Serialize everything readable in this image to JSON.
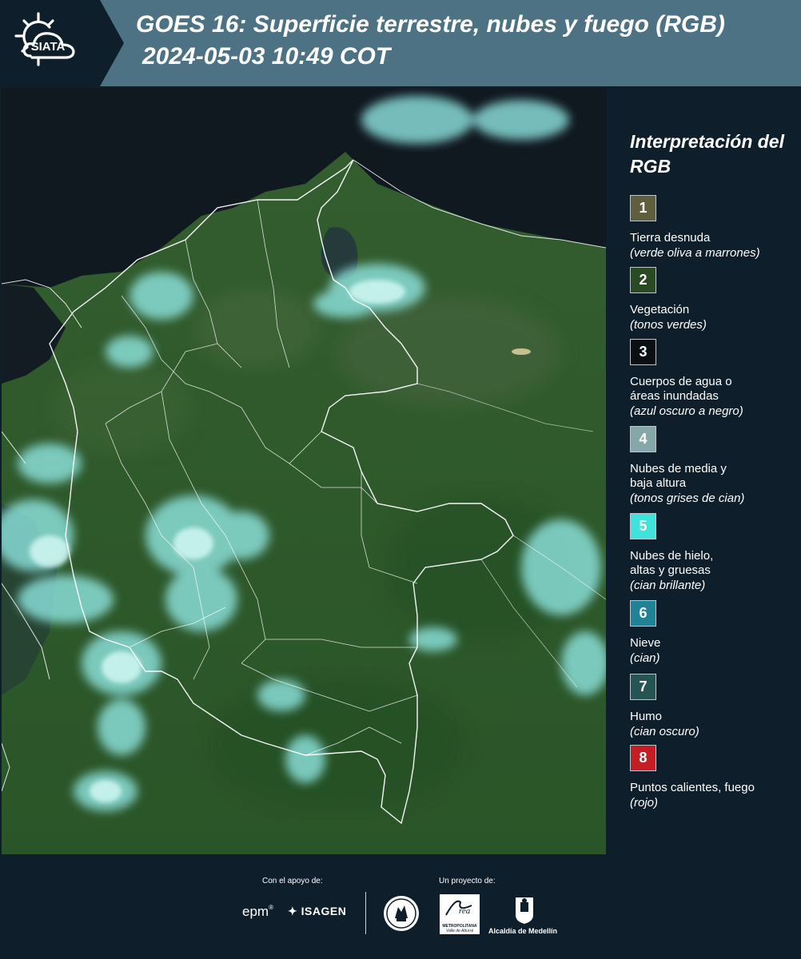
{
  "header": {
    "logo_text": "SIATA",
    "title": "GOES 16: Superficie terrestre, nubes y fuego (RGB)",
    "timestamp": "2024-05-03 10:49 COT"
  },
  "legend": {
    "title": "Interpretación del RGB",
    "items": [
      {
        "number": "1",
        "label": "Tierra desnuda",
        "note": "(verde oliva a marrones)",
        "color": "#5f5e3f"
      },
      {
        "number": "2",
        "label": "Vegetación",
        "note": "(tonos verdes)",
        "color": "#2a4a24"
      },
      {
        "number": "3",
        "label": "Cuerpos de agua o\náreas inundadas",
        "note": "(azul oscuro a negro)",
        "color": "#0a0f14"
      },
      {
        "number": "4",
        "label": "Nubes de media y\nbaja altura",
        "note": "(tonos grises de cian)",
        "color": "#86a7a8"
      },
      {
        "number": "5",
        "label": "Nubes de hielo,\naltas y gruesas",
        "note": "(cian brillante)",
        "color": "#3fe2dc"
      },
      {
        "number": "6",
        "label": "Nieve",
        "note": "(cian)",
        "color": "#1f8296"
      },
      {
        "number": "7",
        "label": "Humo",
        "note": "(cian oscuro)",
        "color": "#255453"
      },
      {
        "number": "8",
        "label": "Puntos calientes, fuego",
        "note": "(rojo)",
        "color": "#c31e24"
      }
    ]
  },
  "footer": {
    "support_caption": "Con el apoyo de:",
    "project_caption": "Un proyecto de:",
    "sponsors": [
      "epm",
      "ISAGEN"
    ],
    "metropolitana_text": "METROPOLITANA",
    "metropolitana_sub": "Valle de Aburrá",
    "partner": "Alcaldía de Medellín"
  },
  "colors": {
    "header_bg": "#4d7283",
    "page_bg": "#0e1f2b",
    "vegetation": "#2f5a2c",
    "cloud_cyan": "#7fe3e0",
    "border_white": "#ffffff"
  }
}
